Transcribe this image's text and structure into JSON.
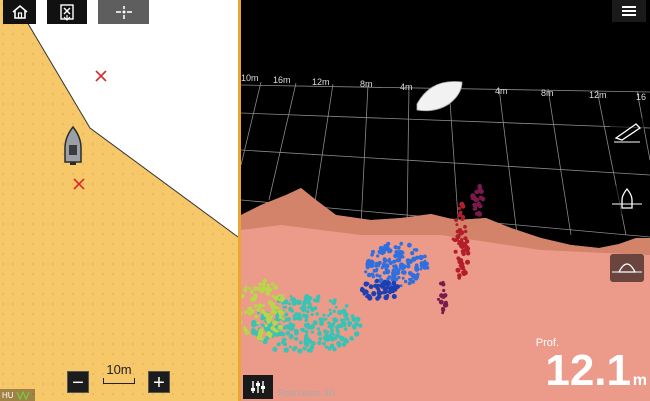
{
  "map": {
    "top_buttons": [
      {
        "name": "home-button",
        "icon": "home-icon"
      },
      {
        "name": "waypoint-button",
        "icon": "waypoint-map-icon"
      },
      {
        "name": "find-ship-button",
        "icon": "crosshair-icon"
      }
    ],
    "scale_label": "10m",
    "zoom_out_label": "−",
    "zoom_in_label": "+",
    "orientation_label": "HU"
  },
  "sonar": {
    "menu_icon": "hamburger-menu-icon",
    "grid_labels_top": [
      "10m",
      "16m",
      "12m",
      "8m",
      "4m",
      "4m",
      "8m",
      "12m",
      "16"
    ],
    "side_buttons": [
      {
        "name": "boat-view-button",
        "icon": "boat-angle-icon"
      },
      {
        "name": "side-view-button",
        "icon": "boat-side-icon"
      },
      {
        "name": "front-view-button",
        "icon": "boat-front-icon"
      }
    ],
    "settings_icon": "sliders-icon",
    "mode_label": "RealVision 3D",
    "depth_title": "Prof.",
    "depth_value": "12.1",
    "depth_unit": "m"
  },
  "colors": {
    "land": "#f6c86a",
    "water": "#ffffff",
    "divider": "#e9a634",
    "seabed": "#ec9a8a",
    "marker": "#d82c2c"
  }
}
